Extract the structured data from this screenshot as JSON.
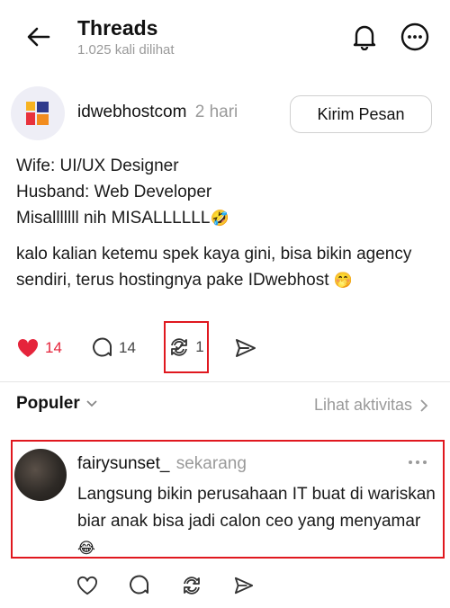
{
  "header": {
    "title": "Threads",
    "subtitle": "1.025 kali dilihat"
  },
  "post": {
    "author": "idwebhostcom",
    "time": "2 hari",
    "message_button": "Kirim Pesan",
    "lines1": [
      "Wife: UI/UX Designer",
      "Husband: Web Developer",
      "Misalllllll nih MISALLLLLL"
    ],
    "emoji1": "🤣",
    "text2": "kalo kalian ketemu spek kaya gini, bisa bikin agency sendiri, terus hostingnya pake IDwebhost",
    "emoji2": "🤭",
    "likes": "14",
    "comments": "14",
    "reposts": "1",
    "like_color": "#e5243b"
  },
  "sort": {
    "label": "Populer",
    "activity": "Lihat aktivitas"
  },
  "reply": {
    "author": "fairysunset_",
    "time": "sekarang",
    "text": "Langsung bikin perusahaan IT buat di wariskan biar anak bisa jadi calon ceo yang menyamar",
    "emoji": "😂"
  },
  "highlight_color": "#e0181f"
}
